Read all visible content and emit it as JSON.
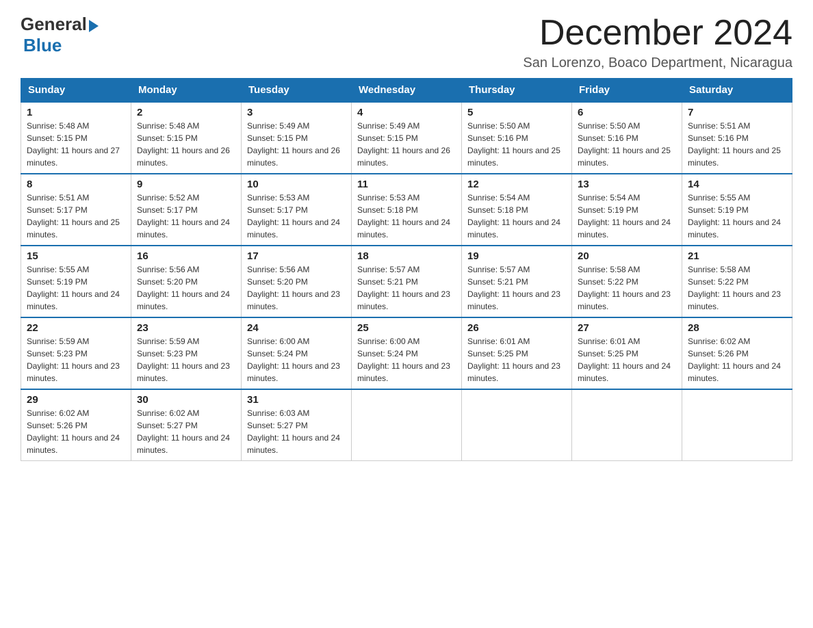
{
  "header": {
    "logo_general": "General",
    "logo_blue": "Blue",
    "month_title": "December 2024",
    "location": "San Lorenzo, Boaco Department, Nicaragua"
  },
  "days_of_week": [
    "Sunday",
    "Monday",
    "Tuesday",
    "Wednesday",
    "Thursday",
    "Friday",
    "Saturday"
  ],
  "weeks": [
    [
      {
        "day": "1",
        "sunrise": "5:48 AM",
        "sunset": "5:15 PM",
        "daylight": "11 hours and 27 minutes."
      },
      {
        "day": "2",
        "sunrise": "5:48 AM",
        "sunset": "5:15 PM",
        "daylight": "11 hours and 26 minutes."
      },
      {
        "day": "3",
        "sunrise": "5:49 AM",
        "sunset": "5:15 PM",
        "daylight": "11 hours and 26 minutes."
      },
      {
        "day": "4",
        "sunrise": "5:49 AM",
        "sunset": "5:15 PM",
        "daylight": "11 hours and 26 minutes."
      },
      {
        "day": "5",
        "sunrise": "5:50 AM",
        "sunset": "5:16 PM",
        "daylight": "11 hours and 25 minutes."
      },
      {
        "day": "6",
        "sunrise": "5:50 AM",
        "sunset": "5:16 PM",
        "daylight": "11 hours and 25 minutes."
      },
      {
        "day": "7",
        "sunrise": "5:51 AM",
        "sunset": "5:16 PM",
        "daylight": "11 hours and 25 minutes."
      }
    ],
    [
      {
        "day": "8",
        "sunrise": "5:51 AM",
        "sunset": "5:17 PM",
        "daylight": "11 hours and 25 minutes."
      },
      {
        "day": "9",
        "sunrise": "5:52 AM",
        "sunset": "5:17 PM",
        "daylight": "11 hours and 24 minutes."
      },
      {
        "day": "10",
        "sunrise": "5:53 AM",
        "sunset": "5:17 PM",
        "daylight": "11 hours and 24 minutes."
      },
      {
        "day": "11",
        "sunrise": "5:53 AM",
        "sunset": "5:18 PM",
        "daylight": "11 hours and 24 minutes."
      },
      {
        "day": "12",
        "sunrise": "5:54 AM",
        "sunset": "5:18 PM",
        "daylight": "11 hours and 24 minutes."
      },
      {
        "day": "13",
        "sunrise": "5:54 AM",
        "sunset": "5:19 PM",
        "daylight": "11 hours and 24 minutes."
      },
      {
        "day": "14",
        "sunrise": "5:55 AM",
        "sunset": "5:19 PM",
        "daylight": "11 hours and 24 minutes."
      }
    ],
    [
      {
        "day": "15",
        "sunrise": "5:55 AM",
        "sunset": "5:19 PM",
        "daylight": "11 hours and 24 minutes."
      },
      {
        "day": "16",
        "sunrise": "5:56 AM",
        "sunset": "5:20 PM",
        "daylight": "11 hours and 24 minutes."
      },
      {
        "day": "17",
        "sunrise": "5:56 AM",
        "sunset": "5:20 PM",
        "daylight": "11 hours and 23 minutes."
      },
      {
        "day": "18",
        "sunrise": "5:57 AM",
        "sunset": "5:21 PM",
        "daylight": "11 hours and 23 minutes."
      },
      {
        "day": "19",
        "sunrise": "5:57 AM",
        "sunset": "5:21 PM",
        "daylight": "11 hours and 23 minutes."
      },
      {
        "day": "20",
        "sunrise": "5:58 AM",
        "sunset": "5:22 PM",
        "daylight": "11 hours and 23 minutes."
      },
      {
        "day": "21",
        "sunrise": "5:58 AM",
        "sunset": "5:22 PM",
        "daylight": "11 hours and 23 minutes."
      }
    ],
    [
      {
        "day": "22",
        "sunrise": "5:59 AM",
        "sunset": "5:23 PM",
        "daylight": "11 hours and 23 minutes."
      },
      {
        "day": "23",
        "sunrise": "5:59 AM",
        "sunset": "5:23 PM",
        "daylight": "11 hours and 23 minutes."
      },
      {
        "day": "24",
        "sunrise": "6:00 AM",
        "sunset": "5:24 PM",
        "daylight": "11 hours and 23 minutes."
      },
      {
        "day": "25",
        "sunrise": "6:00 AM",
        "sunset": "5:24 PM",
        "daylight": "11 hours and 23 minutes."
      },
      {
        "day": "26",
        "sunrise": "6:01 AM",
        "sunset": "5:25 PM",
        "daylight": "11 hours and 23 minutes."
      },
      {
        "day": "27",
        "sunrise": "6:01 AM",
        "sunset": "5:25 PM",
        "daylight": "11 hours and 24 minutes."
      },
      {
        "day": "28",
        "sunrise": "6:02 AM",
        "sunset": "5:26 PM",
        "daylight": "11 hours and 24 minutes."
      }
    ],
    [
      {
        "day": "29",
        "sunrise": "6:02 AM",
        "sunset": "5:26 PM",
        "daylight": "11 hours and 24 minutes."
      },
      {
        "day": "30",
        "sunrise": "6:02 AM",
        "sunset": "5:27 PM",
        "daylight": "11 hours and 24 minutes."
      },
      {
        "day": "31",
        "sunrise": "6:03 AM",
        "sunset": "5:27 PM",
        "daylight": "11 hours and 24 minutes."
      },
      null,
      null,
      null,
      null
    ]
  ]
}
